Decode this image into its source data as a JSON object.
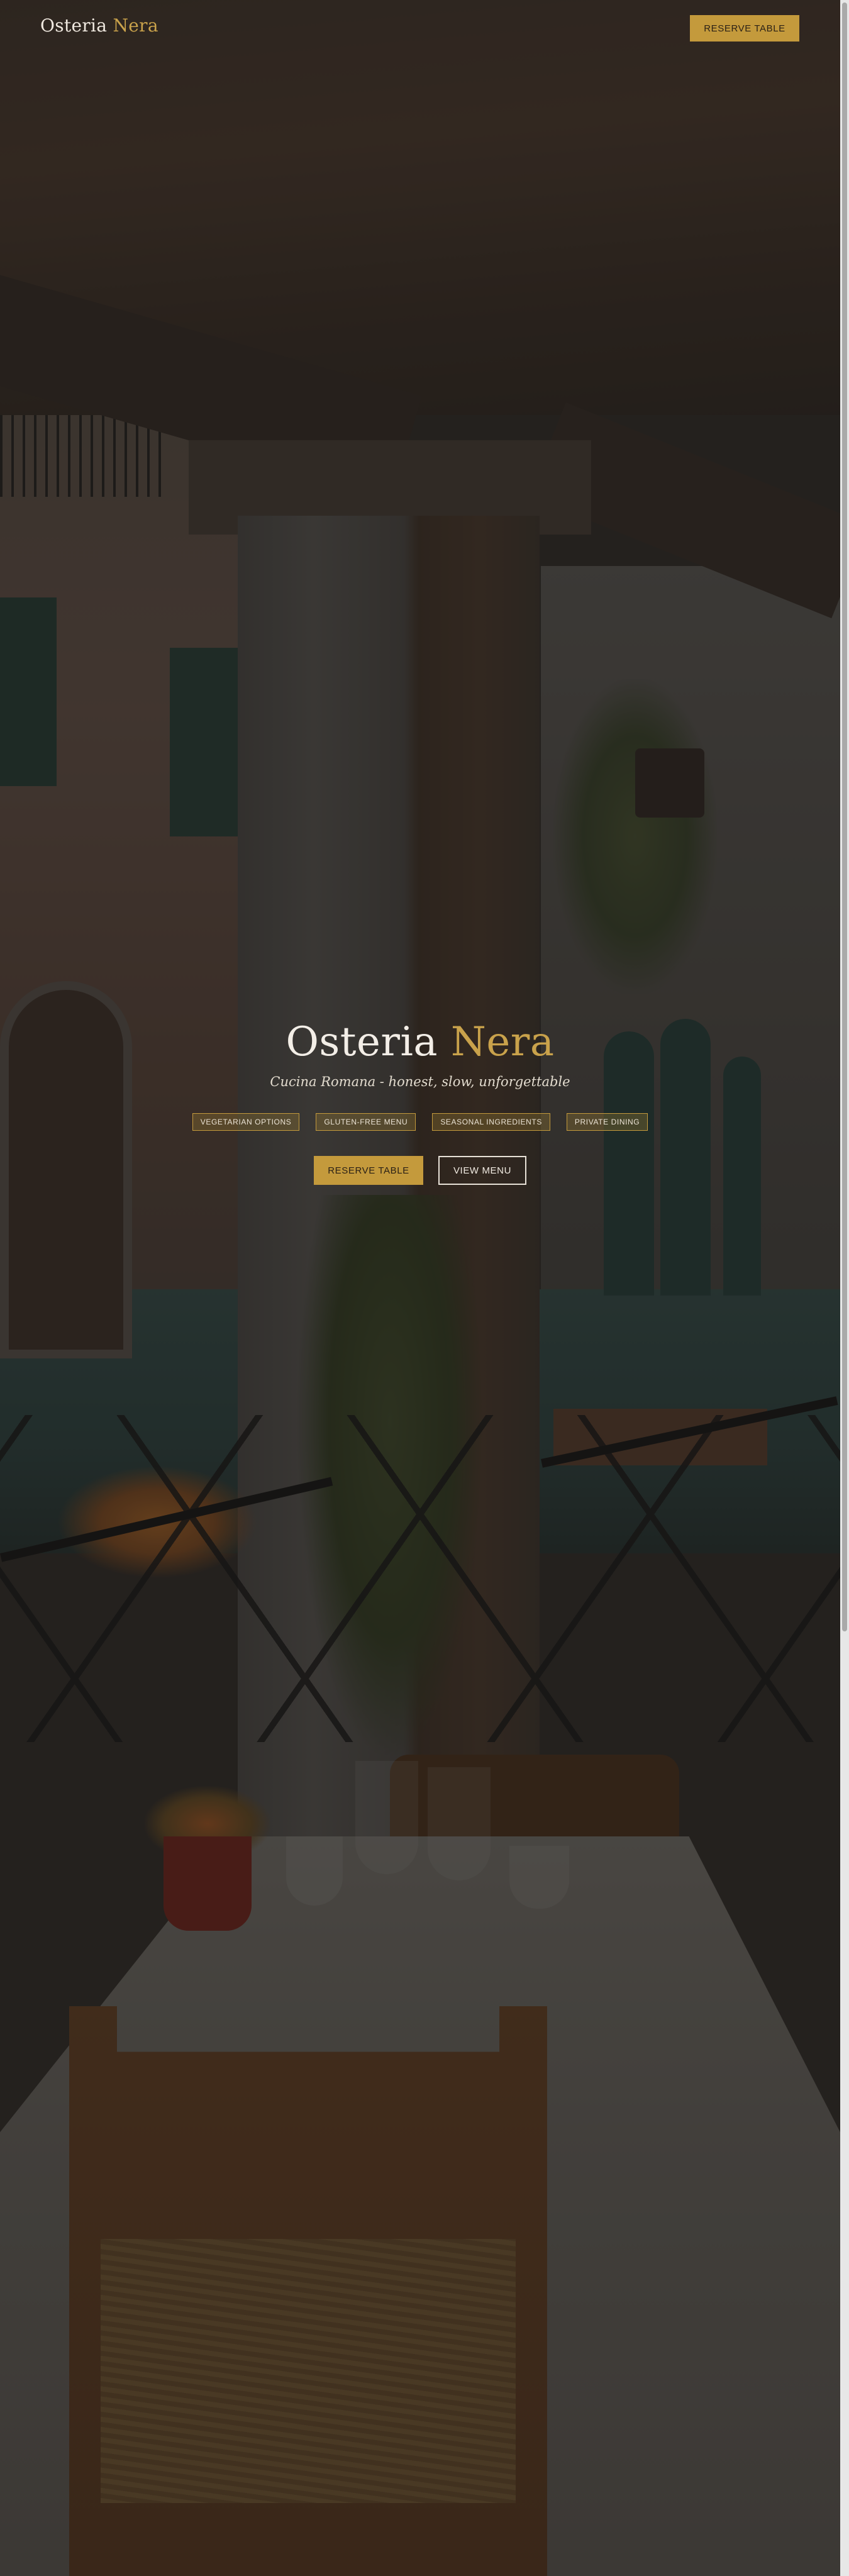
{
  "header": {
    "logo_primary": "Osteria",
    "logo_accent": "Nera",
    "reserve_label": "RESERVE TABLE"
  },
  "hero": {
    "title_primary": "Osteria",
    "title_accent": "Nera",
    "subtitle": "Cucina Romana - honest, slow, unforgettable",
    "tags": [
      "VEGETARIAN OPTIONS",
      "GLUTEN-FREE MENU",
      "SEASONAL INGREDIENTS",
      "PRIVATE DINING"
    ],
    "primary_cta": "RESERVE TABLE",
    "secondary_cta": "VIEW MENU"
  },
  "colors": {
    "accent_gold": "#c49a3c",
    "text_light": "#f3eee7",
    "overlay": "#12100f"
  }
}
